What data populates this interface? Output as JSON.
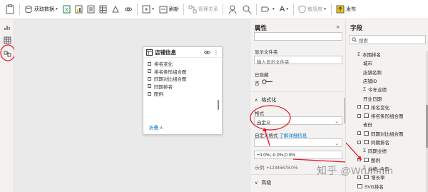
{
  "ribbon": {
    "get_data_label": "获取数据",
    "refresh_label": "刷新",
    "manage_relations_label": "管理关系",
    "format_letter": "A",
    "sensitivity_label": "敏感度",
    "publish_label": "发布"
  },
  "card": {
    "title": "店铺信息",
    "items": [
      "排名变化",
      "排名条形组合图",
      "同期对比组合图",
      "同期排名",
      "图例"
    ],
    "collapse_label": "折叠 ∧"
  },
  "properties": {
    "title": "属性",
    "display_folder_label": "显示文件夹",
    "display_folder_placeholder": "输入显示文件夹",
    "hidden_label": "已隐藏",
    "hidden_value": "否",
    "format_section": "格式化",
    "format_label": "格式",
    "format_value": "自定义",
    "custom_format_label": "自定义格式",
    "learn_more_link": "了解详细信息",
    "custom_format_value": "+0.0%;-0.0%;0.0%",
    "example_text": "示例: +12345678.0%",
    "advanced_section": "高级"
  },
  "fields": {
    "title": "字段",
    "search_placeholder": "搜索",
    "items": [
      {
        "label": "本期排名",
        "kind": "sigma",
        "checkbox": false,
        "indent": 0
      },
      {
        "label": "城市",
        "kind": "plain",
        "checkbox": false,
        "indent": 1
      },
      {
        "label": "店铺名称",
        "kind": "plain",
        "checkbox": false,
        "indent": 1
      },
      {
        "label": "店铺ID",
        "kind": "plain",
        "checkbox": false,
        "indent": 1
      },
      {
        "label": "今年业绩",
        "kind": "sigma",
        "checkbox": false,
        "indent": 1
      },
      {
        "label": "开业日期",
        "kind": "plain",
        "checkbox": false,
        "indent": 1
      },
      {
        "label": "排名变化",
        "kind": "measure",
        "checkbox": true,
        "indent": 0
      },
      {
        "label": "排名条形组合图",
        "kind": "measure",
        "checkbox": true,
        "indent": 0
      },
      {
        "label": "省份",
        "kind": "plain",
        "checkbox": false,
        "indent": 1
      },
      {
        "label": "同期对比组合图",
        "kind": "measure",
        "checkbox": true,
        "indent": 0
      },
      {
        "label": "同期排名",
        "kind": "measure",
        "checkbox": true,
        "indent": 0
      },
      {
        "label": "同期业绩",
        "kind": "sigma",
        "checkbox": false,
        "indent": 1
      },
      {
        "label": "图例",
        "kind": "measure",
        "checkbox": true,
        "indent": 0
      },
      {
        "label": "业绩_今年",
        "kind": "sigma",
        "checkbox": false,
        "indent": 1
      },
      {
        "label": "增长率",
        "kind": "measure",
        "checkbox": true,
        "indent": 0
      },
      {
        "label": "SVG排名",
        "kind": "measure",
        "checkbox": false,
        "indent": 0
      }
    ]
  },
  "watermark": "知乎 @Wrunmin",
  "colors": {
    "accent": "#0078d4",
    "annotation_red": "#e81123",
    "pane_bg": "#f3f2f1",
    "canvas_bg": "#eaeaea"
  }
}
